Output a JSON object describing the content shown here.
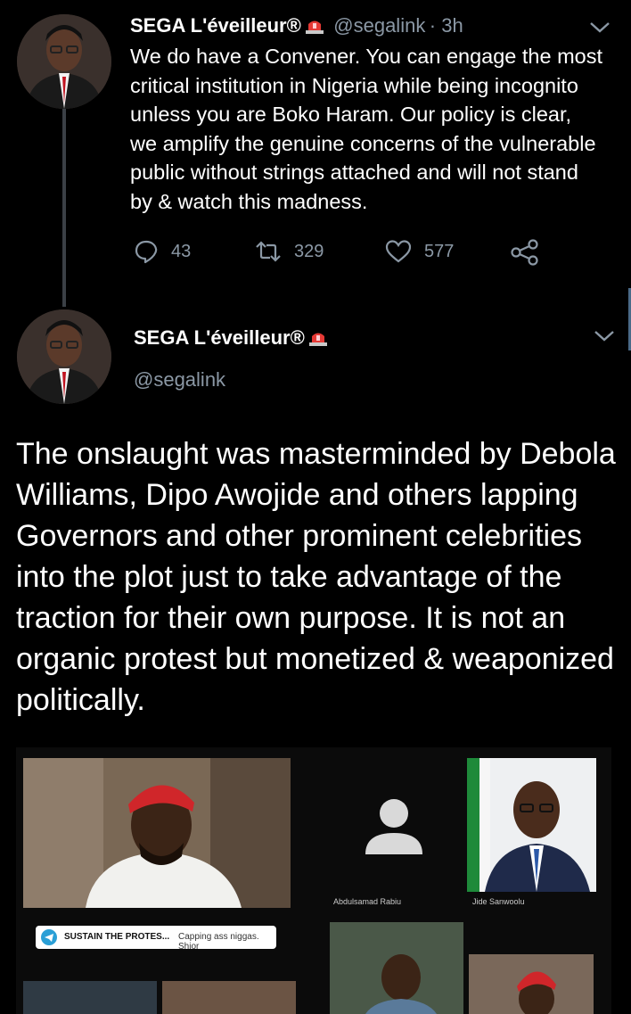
{
  "tweet1": {
    "display_name": "SEGA L'éveilleur®",
    "handle": "@segalink",
    "time": "· 3h",
    "text": "We do have a Convener. You can engage the most critical institution in Nigeria while being incognito unless you are Boko Haram. Our policy is clear, we amplify the genuine concerns of the vulnerable public without strings attached and will not stand by & watch this madness.",
    "replies": "43",
    "retweets": "329",
    "likes": "577"
  },
  "tweet2": {
    "display_name": "SEGA L'éveilleur®",
    "handle": "@segalink",
    "text": "The onslaught was masterminded by Debola Williams, Dipo Awojide and others lapping Governors and other prominent celebrities into the plot just to take advantage of the traction for their own purpose. It is not an organic protest but monetized & weaponized politically."
  },
  "media": {
    "participant_1": "Abdulsamad Rabiu",
    "participant_2": "Jide Sanwoolu",
    "chat_title": "SUSTAIN THE PROTES...",
    "chat_preview": "Capping ass niggas. Shior"
  },
  "icons": [
    "reply-icon",
    "retweet-icon",
    "like-icon",
    "share-icon",
    "chevron-down-icon",
    "siren-emoji-icon"
  ],
  "colors": {
    "background": "#000000",
    "text": "#ffffff",
    "muted": "#8b98a5"
  }
}
